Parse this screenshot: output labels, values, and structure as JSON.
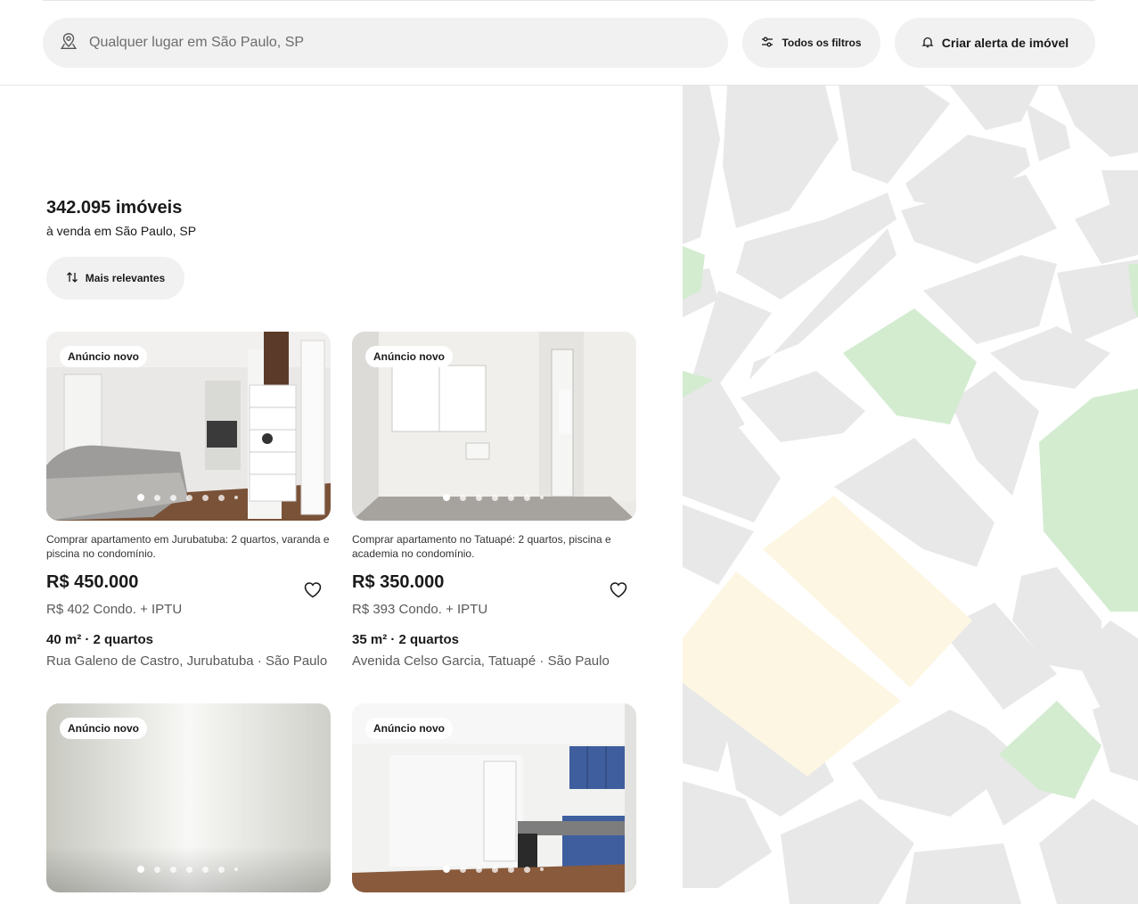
{
  "search": {
    "placeholder": "Qualquer lugar em São Paulo, SP",
    "icon": "location-pin-icon"
  },
  "header": {
    "filters_label": "Todos os filtros",
    "alert_label": "Criar alerta de imóvel"
  },
  "results": {
    "count": "342.095 imóveis",
    "subtitle": "à venda em São Paulo, SP",
    "sort_label": "Mais relevantes"
  },
  "listings": [
    {
      "badge": "Anúncio novo",
      "description": "Comprar apartamento em Jurubatuba: 2 quartos, varanda e piscina no condomínio.",
      "price": "R$ 450.000",
      "condo": "R$ 402 Condo. + IPTU",
      "specs": "40 m² · 2 quartos",
      "address": "Rua Galeno de Castro, Jurubatuba · São Paulo"
    },
    {
      "badge": "Anúncio novo",
      "description": "Comprar apartamento no Tatuapé: 2 quartos, piscina e academia no condomínio.",
      "price": "R$ 350.000",
      "condo": "R$ 393 Condo. + IPTU",
      "specs": "35 m² · 2 quartos",
      "address": "Avenida Celso Garcia, Tatuapé · São Paulo"
    },
    {
      "badge": "Anúncio novo"
    },
    {
      "badge": "Anúncio novo"
    }
  ],
  "colors": {
    "map_block": "#e8e8e8",
    "map_park": "#d3ecd0",
    "map_highlight": "#fdf6e2",
    "pill_bg": "#f1f1f1"
  }
}
